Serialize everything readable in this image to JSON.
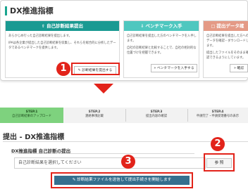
{
  "panel": {
    "title": "DX推進指標",
    "cards": [
      {
        "icon": "upload-icon",
        "header": "自己診断結果提出",
        "text1": "あらかじめ行った自己診断結果を提出します。",
        "text2": "IPAは各企業が提出した自己診断結果を収集し、それらを総合的に分析したデータであるベンチマークを提供します。",
        "button": "診断結果を提出する",
        "color": "#1a9a92"
      },
      {
        "icon": "download-icon",
        "header": "ベンチマーク入手",
        "text1": "自己診断結果を提出した方のベンチマークを入手します。",
        "text2": "自社の診断結果と比較することで、自社の相対的な位置づけを把握できます。",
        "button": "ベンチマークを入手する",
        "color": "#4fc7bf"
      },
      {
        "icon": "document-icon",
        "header": "提出データ確",
        "text1": "自己診断結果を提出した方へのデータを確認・ダウンロードします。",
        "text2": "提出したファイルをそのまま確認できるようにしています。",
        "button": "確認",
        "color": "#e49a86"
      }
    ]
  },
  "callouts": {
    "one": "1",
    "two": "2",
    "three": "3"
  },
  "steps": [
    {
      "num": "STEP.1",
      "label": "自己診断結果のアップロード",
      "active": true
    },
    {
      "num": "STEP.2",
      "label": "連絡事項記載",
      "active": false
    },
    {
      "num": "STEP.3",
      "label": "提出内容の確認",
      "active": false
    },
    {
      "num": "STEP.4",
      "label": "申請完了・申請受理番号の表示",
      "active": false
    }
  ],
  "page": {
    "title": "提出 - DX推進指標",
    "subtitle": "DX推進指標 自己診断の提出",
    "file_placeholder": "自己診断結果を選択してください",
    "ref_button": "参 照",
    "submit_button": "診断結果ファイルを送信して提出手続きを開始します"
  },
  "colors": {
    "accent_red": "#e2231a",
    "step_active": "#7ed27e",
    "submit_bg": "#356f8e"
  }
}
